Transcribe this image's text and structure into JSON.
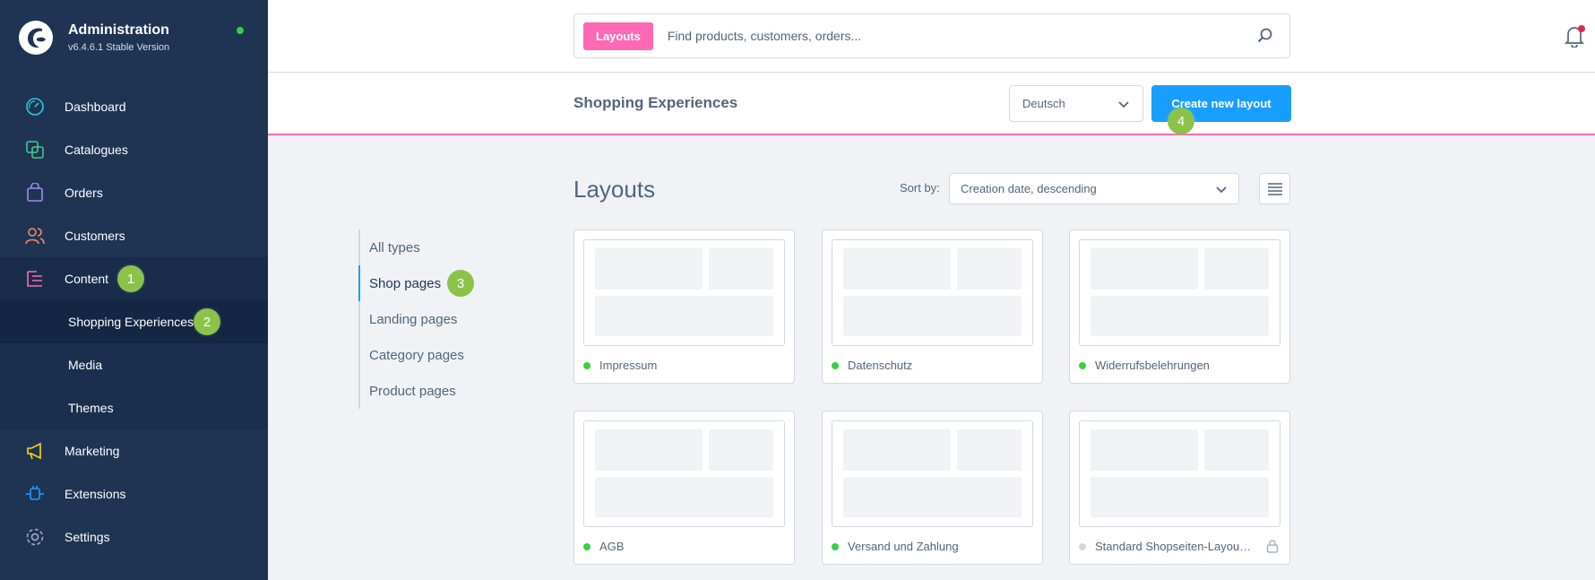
{
  "app": {
    "title": "Administration",
    "version": "v6.4.6.1 Stable Version"
  },
  "sidebar": {
    "items": [
      {
        "label": "Dashboard",
        "icon": "dashboard-icon"
      },
      {
        "label": "Catalogues",
        "icon": "catalogue-icon"
      },
      {
        "label": "Orders",
        "icon": "orders-icon"
      },
      {
        "label": "Customers",
        "icon": "customers-icon"
      },
      {
        "label": "Content",
        "icon": "content-icon"
      },
      {
        "label": "Marketing",
        "icon": "marketing-icon"
      },
      {
        "label": "Extensions",
        "icon": "extensions-icon"
      },
      {
        "label": "Settings",
        "icon": "settings-icon"
      }
    ],
    "subitems": [
      {
        "label": "Shopping Experiences"
      },
      {
        "label": "Media"
      },
      {
        "label": "Themes"
      }
    ]
  },
  "search": {
    "tag": "Layouts",
    "placeholder": "Find products, customers, orders..."
  },
  "header": {
    "title": "Shopping Experiences",
    "language": "Deutsch",
    "create_button": "Create new layout"
  },
  "main": {
    "title": "Layouts",
    "sort_label": "Sort by:",
    "sort_value": "Creation date, descending",
    "types": [
      "All types",
      "Shop pages",
      "Landing pages",
      "Category pages",
      "Product pages"
    ],
    "cards": [
      {
        "name": "Impressum",
        "status": "active"
      },
      {
        "name": "Datenschutz",
        "status": "active"
      },
      {
        "name": "Widerrufsbelehrungen",
        "status": "active"
      },
      {
        "name": "AGB",
        "status": "active"
      },
      {
        "name": "Versand und Zahlung",
        "status": "active"
      },
      {
        "name": "Standard Shopseiten-Layou…",
        "status": "inactive",
        "locked": true
      }
    ]
  },
  "annotations": [
    "1",
    "2",
    "3",
    "4"
  ],
  "colors": {
    "sidebar": "#1f3453",
    "accent": "#189eff",
    "brand_pink": "#ff68b4",
    "annotation": "#8bc24a"
  }
}
